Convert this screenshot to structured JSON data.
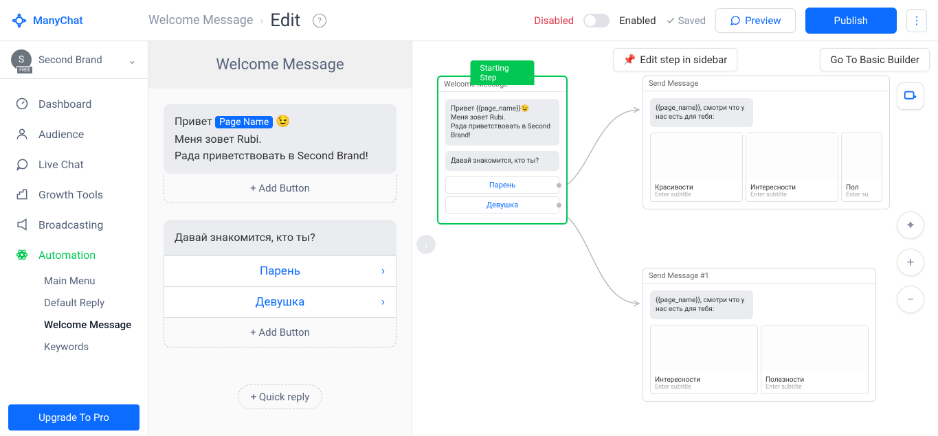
{
  "logo": "ManyChat",
  "breadcrumb": {
    "item": "Welcome Message",
    "current": "Edit"
  },
  "header": {
    "disabled": "Disabled",
    "enabled": "Enabled",
    "saved": "Saved",
    "preview": "Preview",
    "publish": "Publish"
  },
  "brand": {
    "initial": "S",
    "badge": "FREE",
    "name": "Second Brand"
  },
  "nav": {
    "dashboard": "Dashboard",
    "audience": "Audience",
    "livechat": "Live Chat",
    "growth": "Growth Tools",
    "broadcasting": "Broadcasting",
    "automation": "Automation",
    "mainmenu": "Main Menu",
    "defaultreply": "Default Reply",
    "welcomemsg": "Welcome Message",
    "keywords": "Keywords",
    "upgrade": "Upgrade To Pro"
  },
  "editor": {
    "title": "Welcome Message",
    "line1_pre": "Привет ",
    "page_name_chip": "Page Name",
    "emoji": "😉",
    "line2": "Меня зовет Rubi.",
    "line3": "Рада приветствовать в Second Brand!",
    "add_button": "+ Add Button",
    "msg2": "Давай знакомится, кто ты?",
    "option1": "Парень",
    "option2": "Девушка",
    "quick_reply": "+ Quick reply"
  },
  "canvas": {
    "edit_in_sidebar": "Edit step in sidebar",
    "basic_builder": "Go To Basic Builder",
    "starting_step": "Starting Step",
    "node1": {
      "title": "Welcome Message",
      "msg1": "Привет {{page_name}}😉\nМеня зовет Rubi.\nРада приветствовать в Second Brand!",
      "msg2": "Давай знакомится, кто ты?",
      "opt1": "Парень",
      "opt2": "Девушка"
    },
    "node2": {
      "title": "Send Message",
      "msg": "{{page_name}}, смотри что у нас есть для тебя:",
      "card1_title": "Красивости",
      "card1_sub": "Enter subtitle",
      "card2_title": "Интересности",
      "card2_sub": "Enter subtitle",
      "card3_title": "Пол",
      "card3_sub": "Enter su"
    },
    "node3": {
      "title": "Send Message #1",
      "msg": "{{page_name}}, смотри что у нас есть для тебя:",
      "card1_title": "Интересности",
      "card1_sub": "Enter subtitle",
      "card2_title": "Полезности",
      "card2_sub": "Enter subtitle"
    }
  }
}
